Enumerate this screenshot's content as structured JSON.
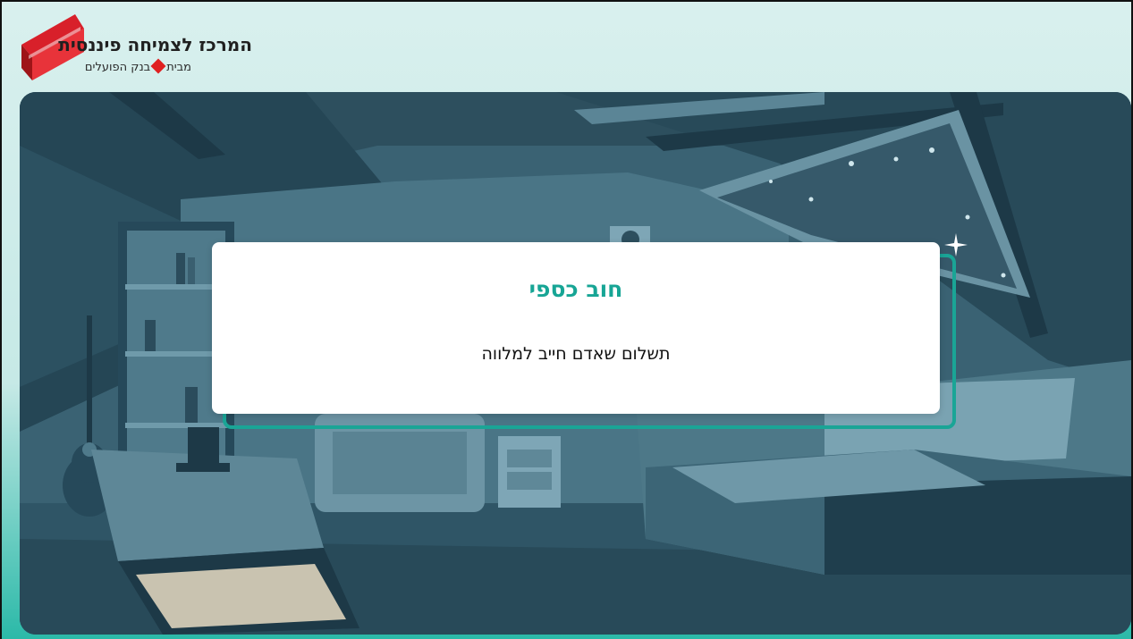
{
  "logo": {
    "title": "המרכז לצמיחה פיננסית",
    "sub_prefix": "מבית",
    "sub_brand": "בנק הפועלים"
  },
  "card": {
    "title": "חוב כספי",
    "body": "תשלום שאדם חייב למלווה"
  },
  "colors": {
    "accent": "#1aa596",
    "title_teal": "#17a595",
    "brand_red": "#d8202a",
    "scene_base": "#2f5566"
  },
  "icons": [
    "logo-mark-icon",
    "diamond-icon",
    "sparkle-icon"
  ]
}
